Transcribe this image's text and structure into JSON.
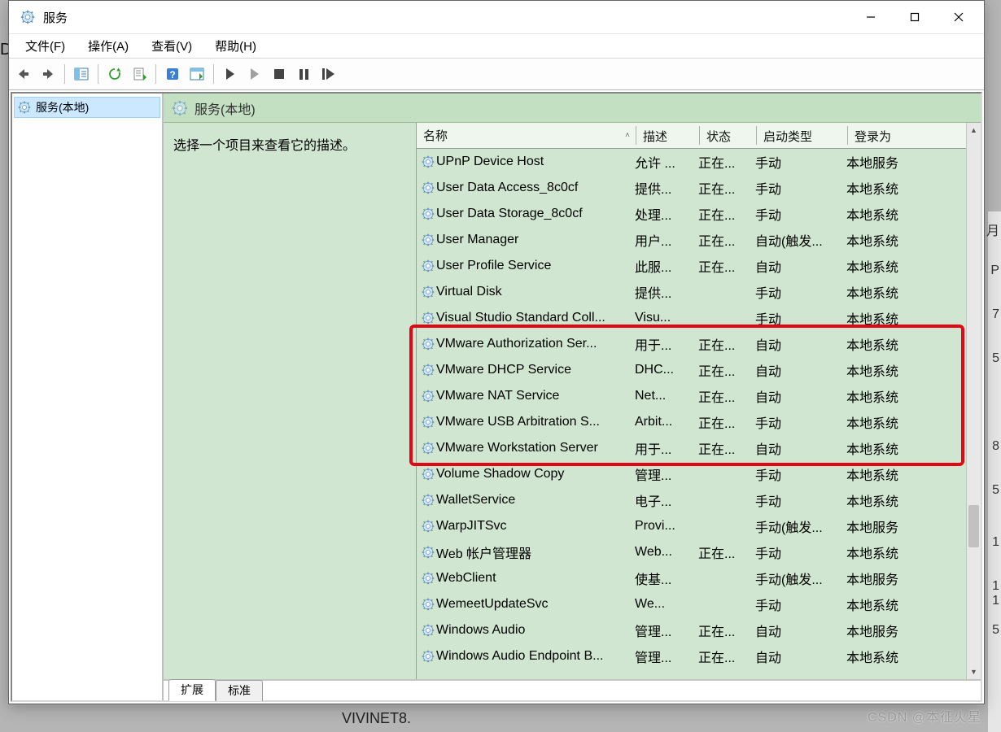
{
  "window": {
    "title": "服务"
  },
  "menu": {
    "file": "文件(F)",
    "action": "操作(A)",
    "view": "查看(V)",
    "help": "帮助(H)"
  },
  "tree": {
    "root": "服务(本地)"
  },
  "detail": {
    "header": "服务(本地)",
    "prompt": "选择一个项目来查看它的描述。"
  },
  "columns": {
    "name": "名称",
    "desc": "描述",
    "state": "状态",
    "stype": "启动类型",
    "logon": "登录为"
  },
  "rows": [
    {
      "name": "UPnP Device Host",
      "desc": "允许 ...",
      "state": "正在...",
      "stype": "手动",
      "logon": "本地服务"
    },
    {
      "name": "User Data Access_8c0cf",
      "desc": "提供...",
      "state": "正在...",
      "stype": "手动",
      "logon": "本地系统"
    },
    {
      "name": "User Data Storage_8c0cf",
      "desc": "处理...",
      "state": "正在...",
      "stype": "手动",
      "logon": "本地系统"
    },
    {
      "name": "User Manager",
      "desc": "用户...",
      "state": "正在...",
      "stype": "自动(触发...",
      "logon": "本地系统"
    },
    {
      "name": "User Profile Service",
      "desc": "此服...",
      "state": "正在...",
      "stype": "自动",
      "logon": "本地系统"
    },
    {
      "name": "Virtual Disk",
      "desc": "提供...",
      "state": "",
      "stype": "手动",
      "logon": "本地系统"
    },
    {
      "name": "Visual Studio Standard Coll...",
      "desc": "Visu...",
      "state": "",
      "stype": "手动",
      "logon": "本地系统"
    },
    {
      "name": "VMware Authorization Ser...",
      "desc": "用于...",
      "state": "正在...",
      "stype": "自动",
      "logon": "本地系统"
    },
    {
      "name": "VMware DHCP Service",
      "desc": "DHC...",
      "state": "正在...",
      "stype": "自动",
      "logon": "本地系统"
    },
    {
      "name": "VMware NAT Service",
      "desc": "Net...",
      "state": "正在...",
      "stype": "自动",
      "logon": "本地系统"
    },
    {
      "name": "VMware USB Arbitration S...",
      "desc": "Arbit...",
      "state": "正在...",
      "stype": "手动",
      "logon": "本地系统"
    },
    {
      "name": "VMware Workstation Server",
      "desc": "用于...",
      "state": "正在...",
      "stype": "自动",
      "logon": "本地系统"
    },
    {
      "name": "Volume Shadow Copy",
      "desc": "管理...",
      "state": "",
      "stype": "手动",
      "logon": "本地系统"
    },
    {
      "name": "WalletService",
      "desc": "电子...",
      "state": "",
      "stype": "手动",
      "logon": "本地系统"
    },
    {
      "name": "WarpJITSvc",
      "desc": "Provi...",
      "state": "",
      "stype": "手动(触发...",
      "logon": "本地服务"
    },
    {
      "name": "Web 帐户管理器",
      "desc": "Web...",
      "state": "正在...",
      "stype": "手动",
      "logon": "本地系统"
    },
    {
      "name": "WebClient",
      "desc": "使基...",
      "state": "",
      "stype": "手动(触发...",
      "logon": "本地服务"
    },
    {
      "name": "WemeetUpdateSvc",
      "desc": "We...",
      "state": "",
      "stype": "手动",
      "logon": "本地系统"
    },
    {
      "name": "Windows Audio",
      "desc": "管理...",
      "state": "正在...",
      "stype": "自动",
      "logon": "本地服务"
    },
    {
      "name": "Windows Audio Endpoint B...",
      "desc": "管理...",
      "state": "正在...",
      "stype": "自动",
      "logon": "本地系统"
    }
  ],
  "highlight": {
    "start_index": 7,
    "end_index": 11
  },
  "tabs": {
    "extended": "扩展",
    "standard": "标准"
  },
  "bg": {
    "letter_left": "D",
    "numbers": [
      "月",
      "P",
      "7",
      "5",
      "8",
      "5",
      "1",
      "1",
      "1",
      "5"
    ],
    "bottom_text": "VIVINET8.",
    "watermark": "CSDN @本征火星"
  }
}
